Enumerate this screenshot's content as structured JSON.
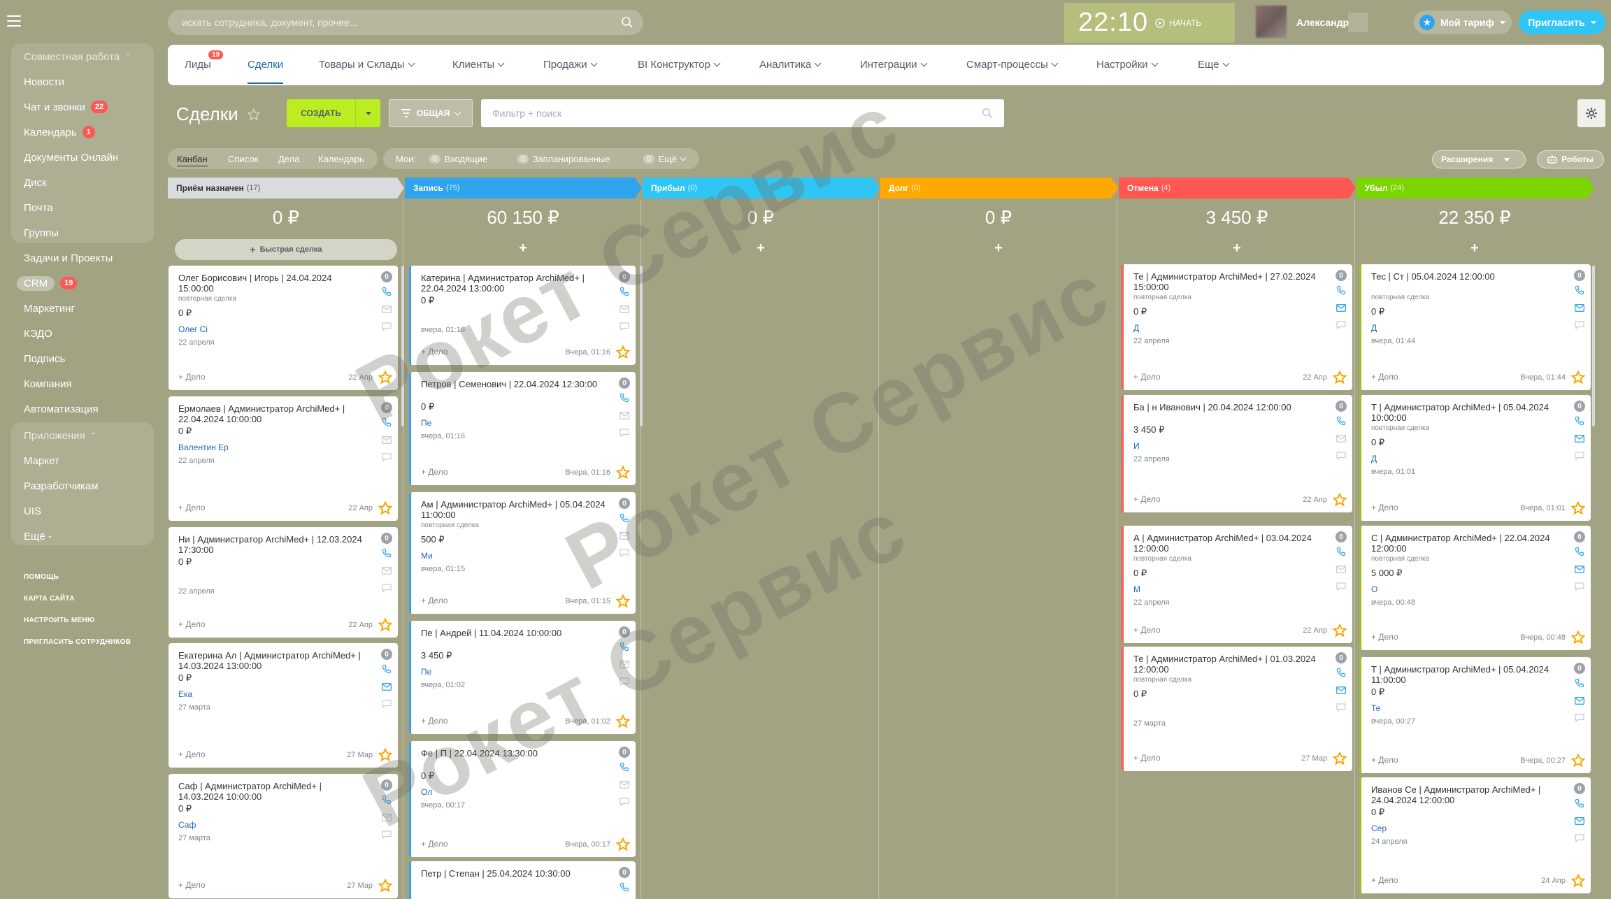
{
  "header": {
    "search_placeholder": "искать сотрудника, документ, прочее...",
    "time": "22:10",
    "start_label": "НАЧАТЬ",
    "user_name": "Александр",
    "tariff_label": "Мой тариф",
    "invite_label": "Пригласить"
  },
  "sidebar": {
    "group1_title": "Совместная работа",
    "items": [
      {
        "label": "Новости"
      },
      {
        "label": "Чат и звонки",
        "counter": "22"
      },
      {
        "label": "Календарь",
        "counter": "1"
      },
      {
        "label": "Документы Онлайн"
      },
      {
        "label": "Диск"
      },
      {
        "label": "Почта"
      },
      {
        "label": "Группы"
      },
      {
        "label": "Задачи и Проекты"
      },
      {
        "label": "CRM",
        "counter": "19"
      },
      {
        "label": "Маркетинг"
      },
      {
        "label": "КЭДО"
      },
      {
        "label": "Подпись"
      },
      {
        "label": "Компания"
      },
      {
        "label": "Автоматизация"
      }
    ],
    "group2_title": "Приложения",
    "apps": [
      {
        "label": "Маркет"
      },
      {
        "label": "Разработчикам"
      },
      {
        "label": "UIS"
      },
      {
        "label": "Ещё -"
      }
    ],
    "footer": [
      "ПОМОЩЬ",
      "КАРТА САЙТА",
      "НАСТРОИТЬ МЕНЮ",
      "ПРИГЛАСИТЬ СОТРУДНИКОВ"
    ]
  },
  "topnav": {
    "items": [
      {
        "label": "Лиды",
        "badge": "19"
      },
      {
        "label": "Сделки"
      },
      {
        "label": "Товары и Склады"
      },
      {
        "label": "Клиенты"
      },
      {
        "label": "Продажи"
      },
      {
        "label": "BI Конструктор"
      },
      {
        "label": "Аналитика"
      },
      {
        "label": "Интеграции"
      },
      {
        "label": "Смарт-процессы"
      },
      {
        "label": "Настройки"
      },
      {
        "label": "Еще"
      }
    ]
  },
  "toolbar": {
    "title": "Сделки",
    "create_label": "СОЗДАТЬ",
    "general_label": "ОБЩАЯ",
    "filter_placeholder": "Фильтр + поиск"
  },
  "views": {
    "items": [
      "Канбан",
      "Список",
      "Дела",
      "Календарь"
    ],
    "my_label": "Мои:",
    "incoming": "Входящие",
    "incoming_count": "0",
    "planned": "Запланированные",
    "planned_count": "0",
    "more": "Ещё",
    "more_count": "0",
    "extensions_label": "Расширения",
    "robots_label": "Роботы"
  },
  "quick_deal": "Быстрая сделка",
  "columns": [
    {
      "name": "Приём назначен",
      "count": "(17)",
      "sum": "0 ₽",
      "color": "#d9dbdd"
    },
    {
      "name": "Запись",
      "count": "(75)",
      "sum": "60 150 ₽",
      "color": "#2fa4ee"
    },
    {
      "name": "Прибыл",
      "count": "(0)",
      "sum": "0 ₽",
      "color": "#2fc6f6"
    },
    {
      "name": "Долг",
      "count": "(0)",
      "sum": "0 ₽",
      "color": "#ffa900"
    },
    {
      "name": "Отмена",
      "count": "(4)",
      "sum": "3 450 ₽",
      "color": "#ff5752"
    },
    {
      "name": "Убыл",
      "count": "(24)",
      "sum": "22 350 ₽",
      "color": "#7bd500"
    }
  ],
  "cards": {
    "c1": [
      {
        "title": "Олег Борисович |             Игорь |  24.04.2024 15:00:00",
        "tag": "повторная сделка",
        "sum": "0 ₽",
        "contact": "Олег Сі",
        "date": "22 апреля",
        "act": "+ Дело",
        "meta": "22 Апр",
        "zero": "0"
      },
      {
        "title": "Ермолаев                       |  Администратор ArchiMed+ | 22.04.2024 10:00:00",
        "tag": "",
        "sum": "0 ₽",
        "contact": "Валентин Ер",
        "date": "22 апреля",
        "act": "+ Дело",
        "meta": "22 Апр",
        "zero": "0"
      },
      {
        "title": "Ни                                    |  Администратор ArchiMed+ | 12.03.2024 17:30:00",
        "tag": "",
        "sum": "0 ₽",
        "contact": "",
        "date": "22 апреля",
        "act": "+ Дело",
        "meta": "22 Апр",
        "zero": "0"
      },
      {
        "title": "       Екатерина Ал                  |  Администратор ArchiMed+ | 14.03.2024 13:00:00",
        "tag": "",
        "sum": "0 ₽",
        "contact": "Ека",
        "date": "27 марта",
        "act": "+ Дело",
        "meta": "27 Мар",
        "zero": "0"
      },
      {
        "title": "Саф                                     |  Администратор ArchiMed+ | 14.03.2024 10:00:00",
        "tag": "",
        "sum": "0 ₽",
        "contact": "Саф",
        "date": "27 марта",
        "act": "+ Дело",
        "meta": "27 Мар",
        "zero": "0"
      }
    ],
    "c2": [
      {
        "title": "Катерина               | Администратор ArchiMed+ | 22.04.2024 13:00:00",
        "tag": "",
        "sum": "0 ₽",
        "contact": "",
        "date": "вчера, 01:16",
        "act": "+ Дело",
        "meta": "Вчера, 01:16",
        "zero": "0"
      },
      {
        "title": "Петров                       |  Семенович | 22.04.2024 12:30:00",
        "tag": "",
        "sum": "0 ₽",
        "contact": "Пе",
        "date": "вчера, 01:16",
        "act": "+ Дело",
        "meta": "Вчера, 01:16",
        "zero": "0"
      },
      {
        "title": "Ам                              | Администратор ArchiMed+ | 05.04.2024 11:00:00",
        "tag": "повторная сделка",
        "sum": "500 ₽",
        "contact": "Ми",
        "date": "вчера, 01:15",
        "act": "+ Дело",
        "meta": "Вчера, 01:15",
        "zero": "0"
      },
      {
        "title": "Пе                       |          Андрей  | 11.04.2024 10:00:00",
        "tag": "",
        "sum": "3 450 ₽",
        "contact": "Пе",
        "date": "вчера, 01:02",
        "act": "+ Дело",
        "meta": "Вчера, 01:02",
        "zero": "0"
      },
      {
        "title": "Фе                           | П  | 22.04.2024 13:30:00",
        "tag": "",
        "sum": "0 ₽",
        "contact": "Ол",
        "date": "вчера, 00:17",
        "act": "+ Дело",
        "meta": "Вчера, 00:17",
        "zero": "0"
      },
      {
        "title": "             Петр |                  Степан  | 25.04.2024 10:30:00",
        "tag": "",
        "sum": "",
        "contact": "",
        "date": "",
        "act": "",
        "meta": "",
        "zero": "0"
      }
    ],
    "c5": [
      {
        "title": "Те                              | Администратор ArchiMed+ | 27.02.2024 15:00:00",
        "tag": "повторная сделка",
        "sum": "0 ₽",
        "contact": "Д",
        "date": "22 апреля",
        "act": "+ Дело",
        "meta": "22 Апр",
        "zero": "0"
      },
      {
        "title": "Ба                         |               н  Иванович | 20.04.2024 12:00:00",
        "tag": "",
        "sum": "3 450 ₽",
        "contact": "И",
        "date": "22 апреля",
        "act": "+ Дело",
        "meta": "22 Апр",
        "zero": "0"
      },
      {
        "title": "А                            | Администратор ArchiMed+ | 03.04.2024 12:00:00",
        "tag": "повторная сделка",
        "sum": "0 ₽",
        "contact": "М",
        "date": "22 апреля",
        "act": "+ Дело",
        "meta": "22 Апр",
        "zero": "0"
      },
      {
        "title": "Те                              | Администратор ArchiMed+ | 01.03.2024 12:00:00",
        "tag": "повторная сделка",
        "sum": "0 ₽",
        "contact": "",
        "date": "27 марта",
        "act": "+ Дело",
        "meta": "27 Мар",
        "zero": "0"
      }
    ],
    "c6": [
      {
        "title": "Тес                            | Ст    | 05.04.2024 12:00:00",
        "tag": "повторная сделка",
        "sum": "0 ₽",
        "contact": "Д",
        "date": "вчера, 01:44",
        "act": "+ Дело",
        "meta": "Вчера, 01:44",
        "zero": "0"
      },
      {
        "title": "Т                               | Администратор ArchiMed+ | 05.04.2024 10:00:00",
        "tag": "повторная сделка",
        "sum": "0 ₽",
        "contact": "Д",
        "date": "вчера, 01:01",
        "act": "+ Дело",
        "meta": "Вчера, 01:01",
        "zero": "0"
      },
      {
        "title": "С                               | Администратор ArchiMed+ | 22.04.2024 12:00:00",
        "tag": "повторная сделка",
        "sum": "5 000 ₽",
        "contact": "О",
        "date": "вчера, 00:48",
        "act": "+ Дело",
        "meta": "Вчера, 00:48",
        "zero": "0"
      },
      {
        "title": "Т                               | Администратор ArchiMed+ | 05.04.2024 11:00:00",
        "tag": "",
        "sum": "0 ₽",
        "contact": "Те",
        "date": "вчера, 00:27",
        "act": "+ Дело",
        "meta": "Вчера, 00:27",
        "zero": "0"
      },
      {
        "title": "Иванов Се                    | Администратор ArchiMed+ | 24.04.2024 12:00:00",
        "tag": "",
        "sum": "0 ₽",
        "contact": "Сер",
        "date": "24 апреля",
        "act": "+ Дело",
        "meta": "24 Апр",
        "zero": "0"
      }
    ]
  },
  "watermark": "Рокет Сервис",
  "colors": {
    "accent": "#2066b0",
    "create": "#bbed21",
    "invite": "#2fc6f6",
    "counter": "#ff5752",
    "star": "#f7a700"
  }
}
